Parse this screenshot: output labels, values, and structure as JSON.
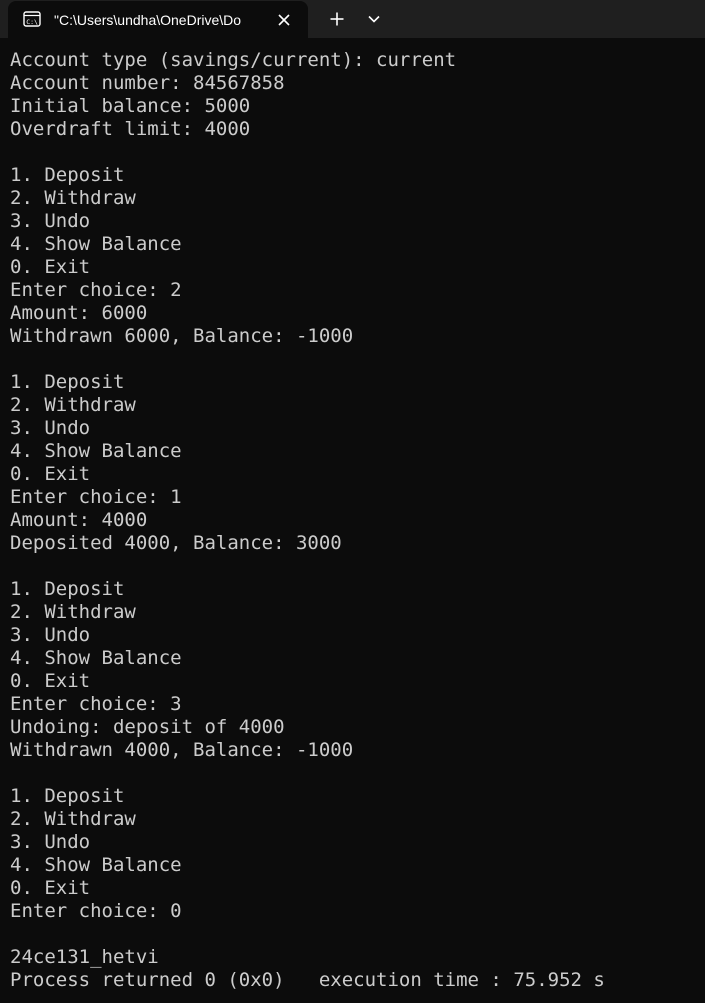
{
  "window": {
    "tab_title": "\"C:\\Users\\undha\\OneDrive\\Do",
    "icons": {
      "tab": "console-icon",
      "close": "close-icon",
      "new_tab": "plus-icon",
      "dropdown": "chevron-down-icon"
    },
    "colors": {
      "background": "#0c0c0c",
      "tabbar": "#1f1f1f",
      "text": "#cccccc"
    }
  },
  "console": {
    "lines": [
      "Account type (savings/current): current",
      "Account number: 84567858",
      "Initial balance: 5000",
      "Overdraft limit: 4000",
      "",
      "1. Deposit",
      "2. Withdraw",
      "3. Undo",
      "4. Show Balance",
      "0. Exit",
      "Enter choice: 2",
      "Amount: 6000",
      "Withdrawn 6000, Balance: -1000",
      "",
      "1. Deposit",
      "2. Withdraw",
      "3. Undo",
      "4. Show Balance",
      "0. Exit",
      "Enter choice: 1",
      "Amount: 4000",
      "Deposited 4000, Balance: 3000",
      "",
      "1. Deposit",
      "2. Withdraw",
      "3. Undo",
      "4. Show Balance",
      "0. Exit",
      "Enter choice: 3",
      "Undoing: deposit of 4000",
      "Withdrawn 4000, Balance: -1000",
      "",
      "1. Deposit",
      "2. Withdraw",
      "3. Undo",
      "4. Show Balance",
      "0. Exit",
      "Enter choice: 0",
      "",
      "24ce131_hetvi",
      "Process returned 0 (0x0)   execution time : 75.952 s"
    ]
  }
}
